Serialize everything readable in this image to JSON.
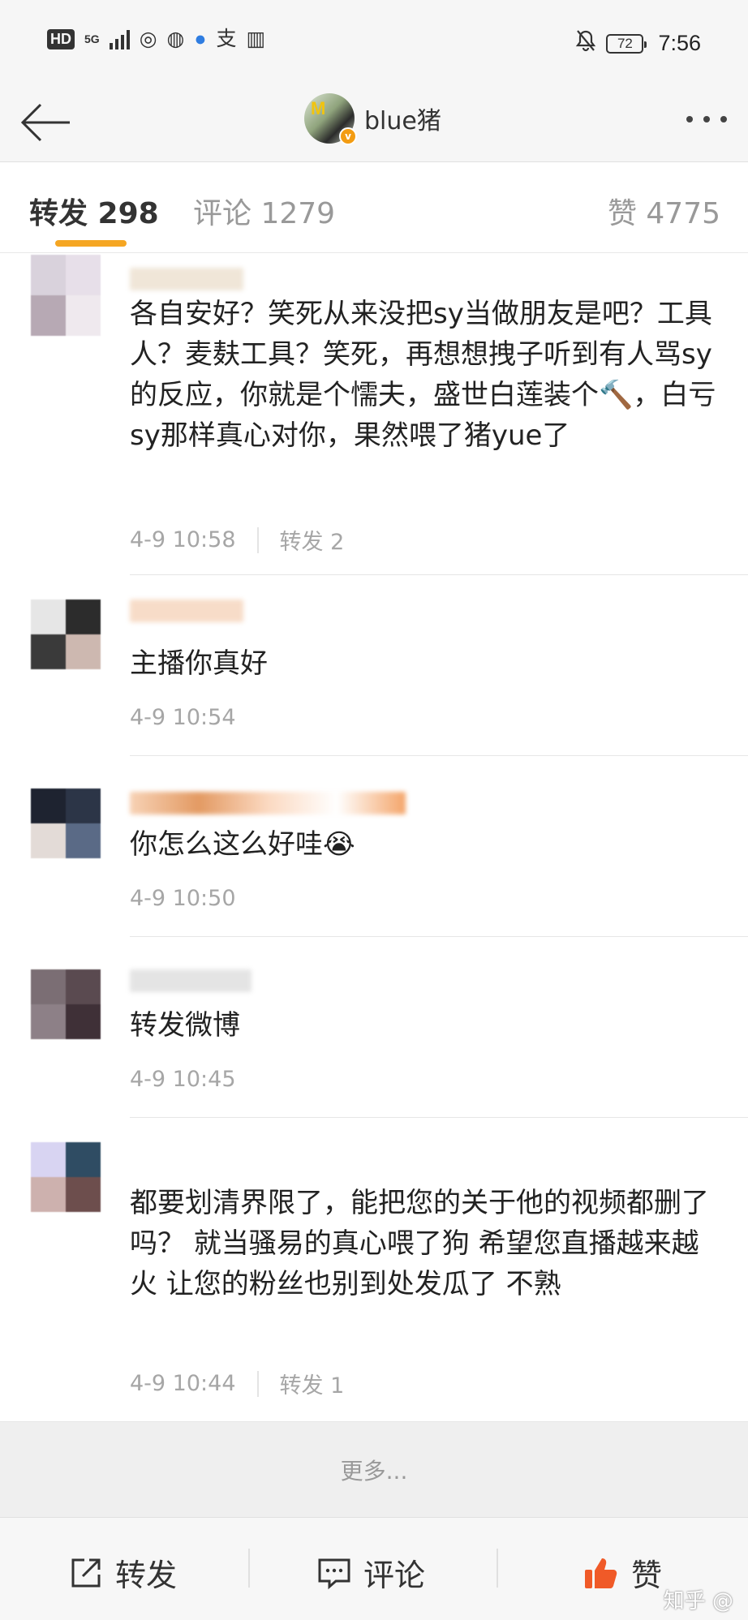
{
  "status_bar": {
    "hd": "HD",
    "network": "5G",
    "time": "7:56",
    "battery": "72",
    "icons": [
      "hd-icon",
      "signal-icon",
      "weibo-icon",
      "wechat-icon",
      "browser-icon",
      "alipay-icon",
      "book-icon",
      "mute-bell-icon",
      "battery-icon"
    ]
  },
  "nav": {
    "title": "blue猪"
  },
  "tabs": {
    "repost": "转发 298",
    "comment": "评论 1279",
    "like": "赞 4775"
  },
  "comments": [
    {
      "text": "各自安好？笑死从来没把sy当做朋友是吧？工具人？麦麸工具？笑死，再想想拽子听到有人骂sy的反应，你就是个懦夫，盛世白莲装个🔨，白亏sy那样真心对你，果然喂了猪yue了",
      "time": "4-9 10:58",
      "repost": "转发 2"
    },
    {
      "text": "主播你真好",
      "time": "4-9 10:54",
      "repost": ""
    },
    {
      "text": "你怎么这么好哇😭",
      "time": "4-9 10:50",
      "repost": ""
    },
    {
      "text": "转发微博",
      "time": "4-9 10:45",
      "repost": ""
    },
    {
      "text": "都要划清界限了，能把您的关于他的视频都删了吗？ 就当骚易的真心喂了狗 希望您直播越来越火 让您的粉丝也别到处发瓜了 不熟",
      "time": "4-9 10:44",
      "repost": "转发 1"
    }
  ],
  "load_more": "更多...",
  "toolbar": {
    "repost": "转发",
    "comment": "评论",
    "like": "赞"
  },
  "watermark": "知乎 @",
  "colors": {
    "accent": "#f5a623",
    "like": "#f05a28",
    "meta": "#a6a6a6"
  }
}
